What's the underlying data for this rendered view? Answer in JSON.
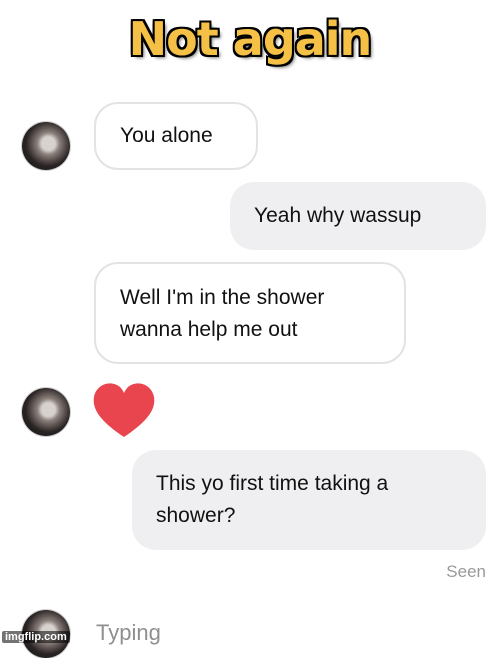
{
  "caption": "Not again",
  "messages": [
    {
      "from": "them",
      "text": "You alone"
    },
    {
      "from": "me",
      "text": "Yeah why wassup"
    },
    {
      "from": "them",
      "text_line1": "Well I'm in the shower",
      "text_line2": "wanna help me out"
    },
    {
      "from": "them",
      "icon": "heart-emoji"
    },
    {
      "from": "me",
      "text_line1": "This yo first time taking a",
      "text_line2": "shower?"
    }
  ],
  "status": {
    "seen": "Seen",
    "typing": "Typing"
  },
  "watermark": "imgflip.com",
  "colors": {
    "caption": "#f5c046",
    "heart": "#e8454f",
    "outgoing_bubble": "#efeff1"
  }
}
